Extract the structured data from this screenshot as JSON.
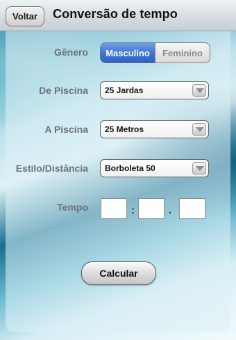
{
  "header": {
    "back_label": "Voltar",
    "title": "Conversão de tempo"
  },
  "form": {
    "genero_label": "Gênero",
    "genero_options": [
      "Masculino",
      "Feminino"
    ],
    "genero_selected": "Masculino",
    "de_piscina_label": "De Piscina",
    "de_piscina_value": "25 Jardas",
    "a_piscina_label": "A Piscina",
    "a_piscina_value": "25 Metros",
    "estilo_label": "Estilo/Distância",
    "estilo_value": "Borboleta 50",
    "tempo_label": "Tempo",
    "tempo_separators": [
      ":",
      "."
    ],
    "tempo_fields": [
      "",
      "",
      ""
    ]
  },
  "actions": {
    "calcular_label": "Calcular"
  },
  "colors": {
    "accent": "#3c73d6"
  }
}
